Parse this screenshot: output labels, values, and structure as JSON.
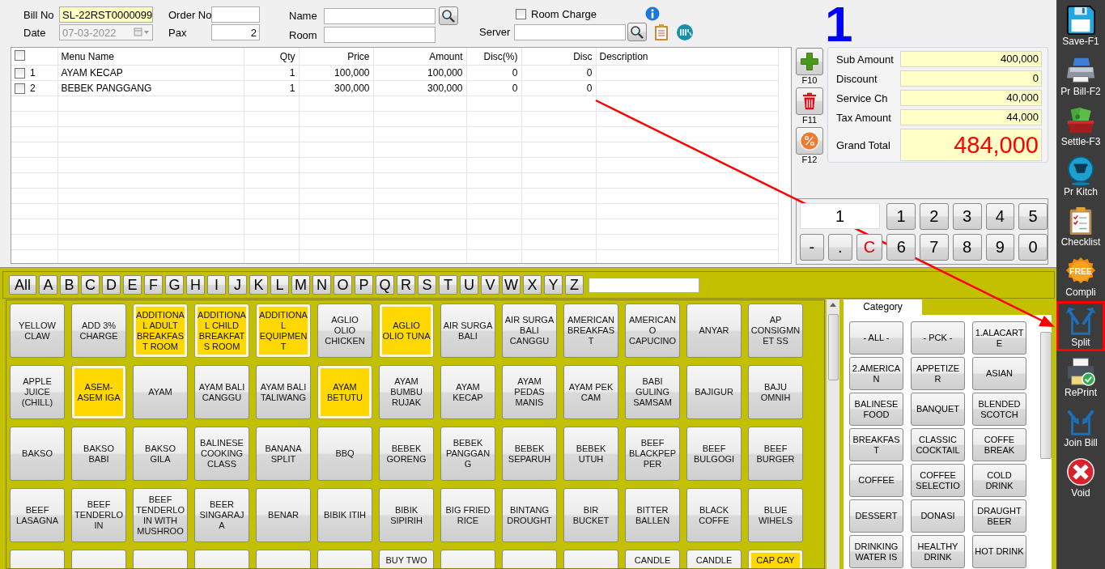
{
  "header": {
    "bill_no": {
      "label": "Bill No",
      "value": "SL-22RST0000099"
    },
    "date": {
      "label": "Date",
      "value": "07-03-2022",
      "disabled": true
    },
    "order_no": {
      "label": "Order No"
    },
    "pax": {
      "label": "Pax",
      "value": "2"
    },
    "name": {
      "label": "Name"
    },
    "room": {
      "label": "Room"
    },
    "room_charge": {
      "label": "Room Charge",
      "checked": false
    },
    "server": {
      "label": "Server"
    }
  },
  "table_number": "1",
  "order_table": {
    "all_checked": false,
    "columns": [
      "Menu Name",
      "Qty",
      "Price",
      "Amount",
      "Disc(%)",
      "Disc",
      "Description"
    ],
    "rows": [
      {
        "no": "1",
        "checked": false,
        "cells": [
          "AYAM KECAP",
          "1",
          "100,000",
          "100,000",
          "0",
          "0"
        ]
      },
      {
        "no": "2",
        "checked": false,
        "cells": [
          "BEBEK PANGGANG",
          "1",
          "300,000",
          "300,000",
          "0",
          "0"
        ]
      }
    ]
  },
  "side_actions": [
    {
      "label": "F10"
    },
    {
      "label": "F11"
    },
    {
      "label": "F12"
    }
  ],
  "totals": [
    {
      "label": "Sub Amount",
      "value": "400,000",
      "kind": "normal"
    },
    {
      "label": "Discount",
      "value": "0",
      "kind": "normal"
    },
    {
      "label": "Service Ch",
      "value": "40,000",
      "kind": "normal"
    },
    {
      "label": "Tax Amount",
      "value": "44,000",
      "kind": "normal"
    },
    {
      "label": "Grand Total",
      "value": "484,000",
      "kind": "grand"
    }
  ],
  "keypad": {
    "display": "1",
    "top_keys": [
      {
        "label": "1"
      },
      {
        "label": "2"
      },
      {
        "label": "3"
      },
      {
        "label": "4"
      },
      {
        "label": "5"
      }
    ],
    "bottom_keys": [
      {
        "label": "-",
        "kind": "symbol"
      },
      {
        "label": ".",
        "kind": "symbol"
      },
      {
        "label": "C",
        "kind": "clear"
      },
      {
        "label": "6",
        "kind": "digit"
      },
      {
        "label": "7",
        "kind": "digit"
      },
      {
        "label": "8",
        "kind": "digit"
      },
      {
        "label": "9",
        "kind": "digit"
      },
      {
        "label": "0",
        "kind": "digit"
      }
    ]
  },
  "letters": [
    "All",
    "A",
    "B",
    "C",
    "D",
    "E",
    "F",
    "G",
    "H",
    "I",
    "J",
    "K",
    "L",
    "M",
    "N",
    "O",
    "P",
    "Q",
    "R",
    "S",
    "T",
    "U",
    "V",
    "W",
    "X",
    "Y",
    "Z"
  ],
  "menu_items": [
    {
      "label": "YELLOW CLAW",
      "highlighted": false
    },
    {
      "label": "ADD 3% CHARGE",
      "highlighted": false
    },
    {
      "label": "ADDITIONAL ADULT BREAKFAST ROOM",
      "highlighted": true
    },
    {
      "label": "ADDITIONAL CHILD BREAKFATS ROOM",
      "highlighted": true
    },
    {
      "label": "ADDITIONAL EQUIPMENT",
      "highlighted": true
    },
    {
      "label": "AGLIO OLIO CHICKEN",
      "highlighted": false
    },
    {
      "label": "AGLIO OLIO TUNA",
      "highlighted": true
    },
    {
      "label": "AIR SURGA BALI",
      "highlighted": false
    },
    {
      "label": "AIR SURGA BALI CANGGU",
      "highlighted": false
    },
    {
      "label": "AMERICAN BREAKFAST",
      "highlighted": false
    },
    {
      "label": "AMERICANO CAPUCINO",
      "highlighted": false
    },
    {
      "label": "ANYAR",
      "highlighted": false
    },
    {
      "label": "AP CONSIGMNET SS",
      "highlighted": false
    },
    {
      "label": "APPLE JUICE (CHILL)",
      "highlighted": false
    },
    {
      "label": "ASEM-ASEM IGA",
      "highlighted": true
    },
    {
      "label": "AYAM",
      "highlighted": false
    },
    {
      "label": "AYAM BALI CANGGU",
      "highlighted": false
    },
    {
      "label": "AYAM BALI TALIWANG",
      "highlighted": false
    },
    {
      "label": "AYAM BETUTU",
      "highlighted": true
    },
    {
      "label": "AYAM BUMBU RUJAK",
      "highlighted": false
    },
    {
      "label": "AYAM KECAP",
      "highlighted": false
    },
    {
      "label": "AYAM PEDAS MANIS",
      "highlighted": false
    },
    {
      "label": "AYAM PEK CAM",
      "highlighted": false
    },
    {
      "label": "BABI GULING SAMSAM",
      "highlighted": false
    },
    {
      "label": "BAJIGUR",
      "highlighted": false
    },
    {
      "label": "BAJU OMNIH",
      "highlighted": false
    },
    {
      "label": "BAKSO",
      "highlighted": false
    },
    {
      "label": "BAKSO BABI",
      "highlighted": false
    },
    {
      "label": "BAKSO GILA",
      "highlighted": false
    },
    {
      "label": "BALINESE COOKING CLASS",
      "highlighted": false
    },
    {
      "label": "BANANA SPLIT",
      "highlighted": false
    },
    {
      "label": "BBQ",
      "highlighted": false
    },
    {
      "label": "BEBEK GORENG",
      "highlighted": false
    },
    {
      "label": "BEBEK PANGGANG",
      "highlighted": false
    },
    {
      "label": "BEBEK SEPARUH",
      "highlighted": false
    },
    {
      "label": "BEBEK UTUH",
      "highlighted": false
    },
    {
      "label": "BEEF BLACKPEPPER",
      "highlighted": false
    },
    {
      "label": "BEEF BULGOGI",
      "highlighted": false
    },
    {
      "label": "BEEF BURGER",
      "highlighted": false
    },
    {
      "label": "BEEF LASAGNA",
      "highlighted": false
    },
    {
      "label": "BEEF TENDERLOIN",
      "highlighted": false
    },
    {
      "label": "BEEF TENDERLOIN WITH MUSHROO",
      "highlighted": false
    },
    {
      "label": "BEER SINGARAJA",
      "highlighted": false
    },
    {
      "label": "BENAR",
      "highlighted": false
    },
    {
      "label": "BIBIK ITIH",
      "highlighted": false
    },
    {
      "label": "BIBIK SIPIRIH",
      "highlighted": false
    },
    {
      "label": "BIG FRIED RICE",
      "highlighted": false
    },
    {
      "label": "BINTANG DROUGHT",
      "highlighted": false
    },
    {
      "label": "BIR BUCKET",
      "highlighted": false
    },
    {
      "label": "BITTER BALLEN",
      "highlighted": false
    },
    {
      "label": "BLACK COFFE",
      "highlighted": false
    },
    {
      "label": "BLUE WIHELS",
      "highlighted": false
    }
  ],
  "menu_items_cut_row": [
    {
      "highlighted": false
    },
    {
      "highlighted": false
    },
    {
      "highlighted": false
    },
    {
      "highlighted": false
    },
    {
      "highlighted": false
    },
    {
      "highlighted": false
    },
    {
      "label": "BUY TWO",
      "highlighted": false
    },
    {
      "highlighted": false
    },
    {
      "highlighted": false
    },
    {
      "highlighted": false
    },
    {
      "label": "CANDLE",
      "highlighted": false
    },
    {
      "label": "CANDLE",
      "highlighted": false
    },
    {
      "label": "CAP CAY",
      "highlighted": true
    }
  ],
  "category_tab": "Category",
  "categories": [
    "- ALL -",
    "- PCK -",
    "1.ALACARTE",
    "2.AMERICAN",
    "APPETIZER",
    "ASIAN",
    "BALINESE FOOD",
    "BANQUET",
    "BLENDED SCOTCH",
    "BREAKFAST",
    "CLASSIC COCKTAIL",
    "COFFE BREAK",
    "COFFEE",
    "COFFEE SELECTIO",
    "COLD DRINK",
    "DESSERT",
    "DONASI",
    "DRAUGHT BEER",
    "DRINKING WATER IS",
    "HEALTHY DRINK",
    "HOT DRINK"
  ],
  "tools": [
    {
      "label": "Save-F1",
      "highlighted": false
    },
    {
      "label": "Pr Bill-F2",
      "highlighted": false
    },
    {
      "label": "Settle-F3",
      "highlighted": false
    },
    {
      "label": "Pr Kitch",
      "highlighted": false
    },
    {
      "label": "Checklist",
      "highlighted": false
    },
    {
      "label": "Compli",
      "badge": "FREE",
      "highlighted": false
    },
    {
      "label": "Split",
      "highlighted": true
    },
    {
      "label": "RePrint",
      "highlighted": false
    },
    {
      "label": "Join Bill",
      "highlighted": false
    },
    {
      "label": "Void",
      "highlighted": false
    }
  ],
  "annotation": {
    "arrow": true
  }
}
